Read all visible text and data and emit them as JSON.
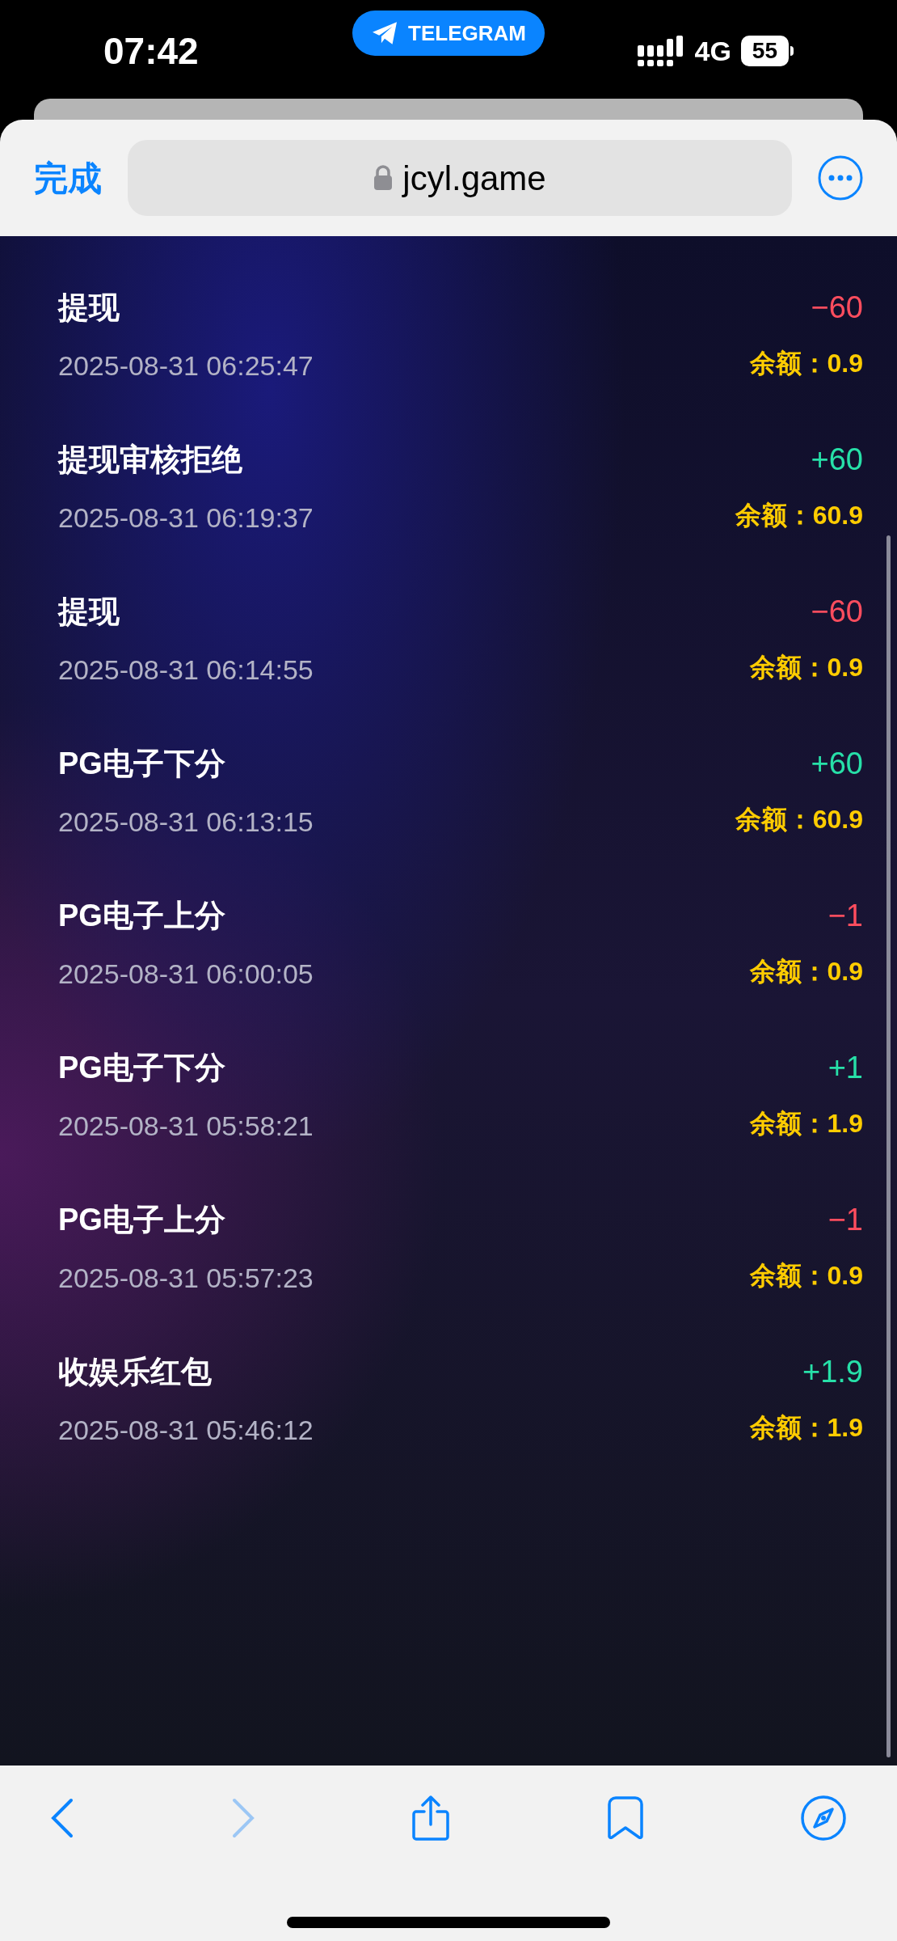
{
  "status_bar": {
    "time": "07:42",
    "app_pill": "TELEGRAM",
    "network": "4G",
    "battery": "55"
  },
  "browser": {
    "done": "完成",
    "url": "jcyl.game"
  },
  "records": [
    {
      "title": "提现",
      "time": "2025-08-31 06:25:47",
      "amount": "−60",
      "kind": "out",
      "balance": "余额：0.9"
    },
    {
      "title": "提现审核拒绝",
      "time": "2025-08-31 06:19:37",
      "amount": "+60",
      "kind": "in",
      "balance": "余额：60.9"
    },
    {
      "title": "提现",
      "time": "2025-08-31 06:14:55",
      "amount": "−60",
      "kind": "out",
      "balance": "余额：0.9"
    },
    {
      "title": "PG电子下分",
      "time": "2025-08-31 06:13:15",
      "amount": "+60",
      "kind": "in",
      "balance": "余额：60.9"
    },
    {
      "title": "PG电子上分",
      "time": "2025-08-31 06:00:05",
      "amount": "−1",
      "kind": "out",
      "balance": "余额：0.9"
    },
    {
      "title": "PG电子下分",
      "time": "2025-08-31 05:58:21",
      "amount": "+1",
      "kind": "in",
      "balance": "余额：1.9"
    },
    {
      "title": "PG电子上分",
      "time": "2025-08-31 05:57:23",
      "amount": "−1",
      "kind": "out",
      "balance": "余额：0.9"
    },
    {
      "title": "收娱乐红包",
      "time": "2025-08-31 05:46:12",
      "amount": "+1.9",
      "kind": "in",
      "balance": "余额：1.9"
    }
  ],
  "toolbar": {
    "forward_disabled": true
  }
}
